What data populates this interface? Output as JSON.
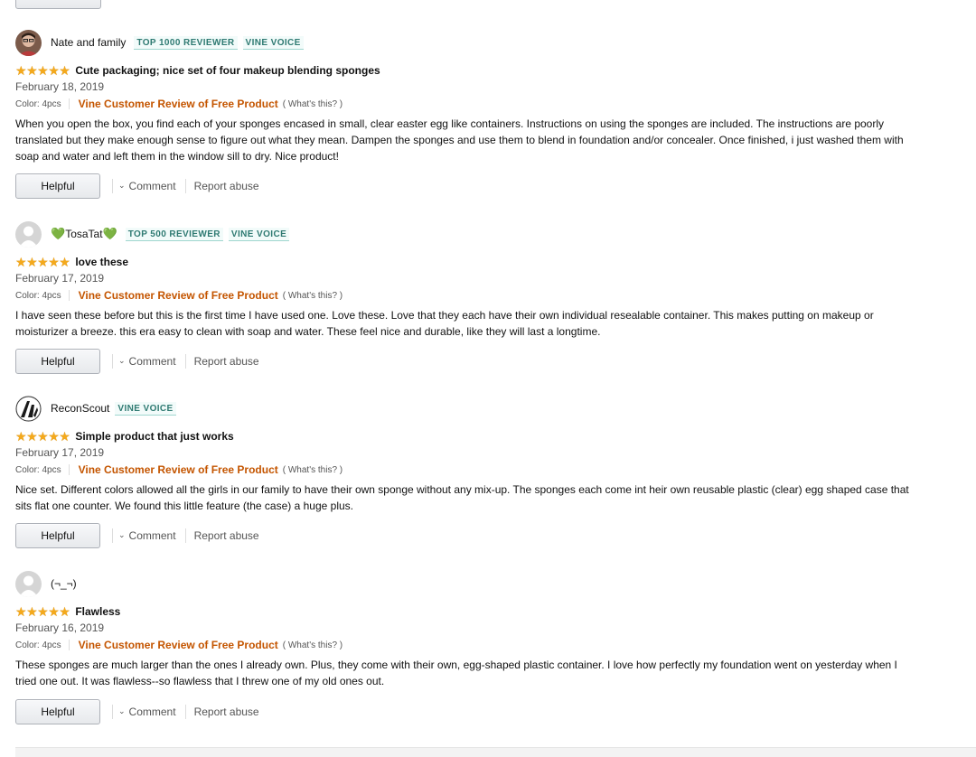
{
  "reviews": [
    {
      "reviewer": "Nate and family",
      "badges": [
        "TOP 1000 REVIEWER",
        "VINE VOICE"
      ],
      "rating": 5,
      "title": "Cute packaging; nice set of four makeup blending sponges",
      "date": "February 18, 2019",
      "color": "Color: 4pcs",
      "vine_label": "Vine Customer Review of Free Product",
      "whats_this": "( What's this? )",
      "body": "When you open the box, you find each of your sponges encased in small, clear easter egg like containers. Instructions on using the sponges are included. The instructions are poorly translated but they make enough sense to figure out what they mean. Dampen the sponges and use them to blend in foundation and/or concealer. Once finished, i just washed them with soap and water and left them in the window sill to dry. Nice product!",
      "helpful_label": "Helpful",
      "comment_label": "Comment",
      "report_label": "Report abuse"
    },
    {
      "reviewer": "TosaTat",
      "badges": [
        "TOP 500 REVIEWER",
        "VINE VOICE"
      ],
      "rating": 5,
      "title": "love these",
      "date": "February 17, 2019",
      "color": "Color: 4pcs",
      "vine_label": "Vine Customer Review of Free Product",
      "whats_this": "( What's this? )",
      "body": "I have seen these before but this is the first time I have used one. Love these. Love that they each have their own individual resealable container. This makes putting on makeup or moisturizer a breeze. this era easy to clean with soap and water. These feel nice and durable, like they will last a longtime.",
      "helpful_label": "Helpful",
      "comment_label": "Comment",
      "report_label": "Report abuse"
    },
    {
      "reviewer": "ReconScout",
      "badges": [
        "VINE VOICE"
      ],
      "rating": 5,
      "title": "Simple product that just works",
      "date": "February 17, 2019",
      "color": "Color: 4pcs",
      "vine_label": "Vine Customer Review of Free Product",
      "whats_this": "( What's this? )",
      "body": "Nice set. Different colors allowed all the girls in our family to have their own sponge without any mix-up. The sponges each come int heir own reusable plastic (clear) egg shaped case that sits flat one counter. We found this little feature (the case) a huge plus.",
      "helpful_label": "Helpful",
      "comment_label": "Comment",
      "report_label": "Report abuse"
    },
    {
      "reviewer": "(¬_¬)",
      "badges": [],
      "rating": 5,
      "title": "Flawless",
      "date": "February 16, 2019",
      "color": "Color: 4pcs",
      "vine_label": "Vine Customer Review of Free Product",
      "whats_this": "( What's this? )",
      "body": "These sponges are much larger than the ones I already own. Plus, they come with their own, egg-shaped plastic container. I love how perfectly my foundation went on yesterday when I tried one out. It was flawless--so flawless that I threw one of my old ones out.",
      "helpful_label": "Helpful",
      "comment_label": "Comment",
      "report_label": "Report abuse"
    }
  ],
  "colors": {
    "star": "#f4a91c",
    "vine_orange": "#c45500",
    "badge_teal": "#2f7a72",
    "heart_green": "#2e9e3a"
  },
  "icons": {
    "rating": "star-icon",
    "comment": "chevron-down-icon",
    "default_avatar": "person-silhouette-icon"
  }
}
